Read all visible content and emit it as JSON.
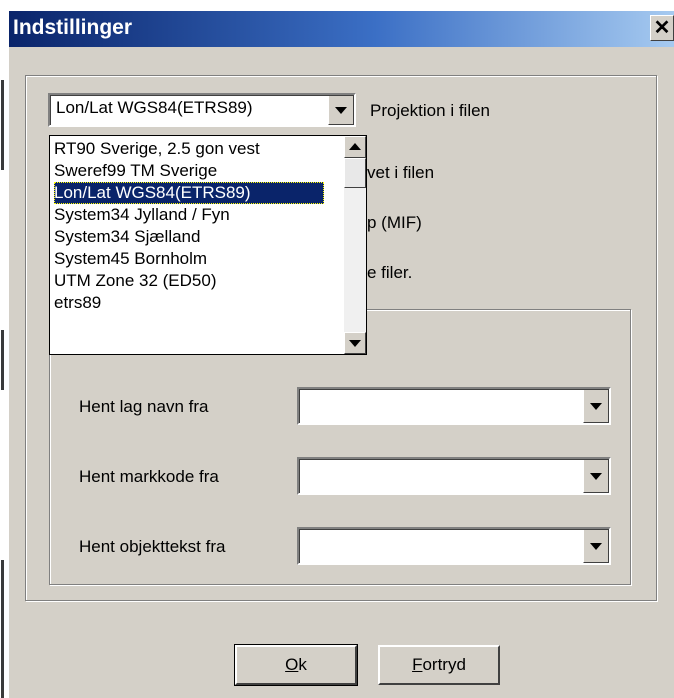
{
  "window": {
    "title": "Indstillinger",
    "close_glyph": "✕"
  },
  "projection": {
    "selected": "Lon/Lat WGS84(ETRS89)",
    "label": "Projektion i filen",
    "options": [
      "RT90 Sverige, 2.5 gon vest",
      "Sweref99 TM Sverige",
      "Lon/Lat WGS84(ETRS89)",
      "System34 Jylland / Fyn",
      "System34 Sjælland",
      "System45 Bornholm",
      "UTM Zone 32 (ED50)",
      "etrs89"
    ],
    "selected_index": 2
  },
  "hidden_partial_labels": {
    "line1": "vet i filen",
    "line2": "p (MIF)",
    "line3": "e filer."
  },
  "fields": {
    "lag_label": "Hent lag navn fra",
    "lag_value": "",
    "markkode_label": "Hent markkode fra",
    "markkode_value": "",
    "objekttekst_label": "Hent objekttekst fra",
    "objekttekst_value": ""
  },
  "buttons": {
    "ok_mnemonic": "O",
    "ok_rest": "k",
    "cancel_mnemonic": "F",
    "cancel_rest": "ortryd"
  },
  "icons": {
    "dropdown": "chevron-down-icon",
    "scroll_up": "arrow-up-icon",
    "scroll_down": "arrow-down-icon",
    "close": "close-icon"
  },
  "colors": {
    "title_bar_start": "#0a246a",
    "title_bar_end": "#a6caf0",
    "dialog_bg": "#d4d0c8",
    "selection_bg": "#0a246a"
  }
}
